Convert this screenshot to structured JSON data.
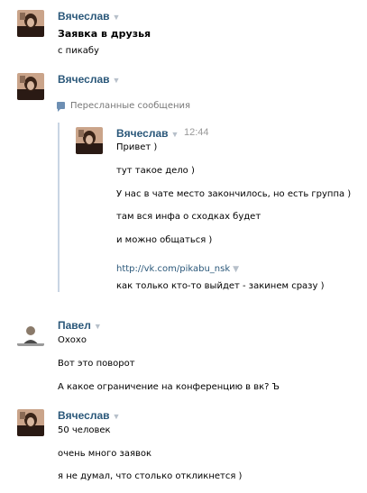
{
  "messages": {
    "m1": {
      "author": "Вячеслав",
      "lines": [
        "Заявка в друзья",
        "с пикабу"
      ]
    },
    "m2": {
      "author": "Вячеслав",
      "forwarded_label": "Пересланные сообщения",
      "forwarded": {
        "author": "Вячеслав",
        "time": "12:44",
        "lines": [
          "Привет )",
          "тут такое дело )",
          "У нас в чате место закончилось, но есть группа )",
          "там вся инфа о сходках будет",
          "и можно общаться )"
        ],
        "link": "http://vk.com/pikabu_nsk",
        "last_line": "как только кто-то выйдет - закинем сразу )"
      }
    },
    "m3": {
      "author": "Павел",
      "lines": [
        "Охохо",
        "Вот это поворот",
        "А какое ограничение на конференцию в вк? Ъ"
      ]
    },
    "m4": {
      "author": "Вячеслав",
      "lines": [
        "50 человек",
        "очень много заявок",
        "я не думал, что столько откликнется )"
      ]
    }
  },
  "icons": {
    "caret": "▼",
    "forward": "forward-messages-icon"
  },
  "colors": {
    "name": "#2b587a",
    "link": "#2b587a",
    "time": "#999999",
    "quote_bar": "#c9d5e3"
  }
}
